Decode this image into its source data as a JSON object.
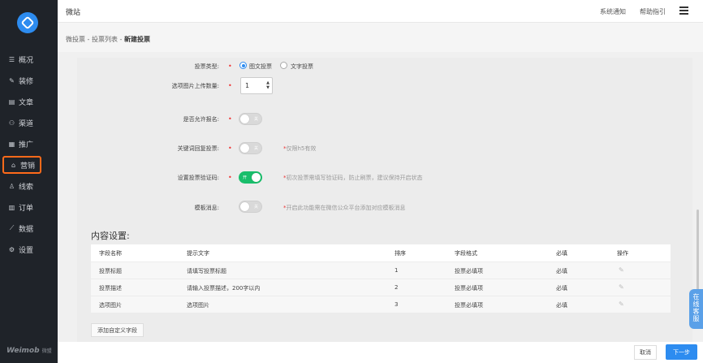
{
  "sidebar": {
    "brand": "Weimob",
    "brand_cn": "微盟",
    "items": [
      {
        "label": "概况",
        "icon": "overview-icon"
      },
      {
        "label": "装修",
        "icon": "decorate-icon"
      },
      {
        "label": "文章",
        "icon": "article-icon"
      },
      {
        "label": "渠道",
        "icon": "channel-icon"
      },
      {
        "label": "推广",
        "icon": "promote-icon"
      },
      {
        "label": "营销",
        "icon": "marketing-icon",
        "active": true
      },
      {
        "label": "线索",
        "icon": "leads-icon"
      },
      {
        "label": "订单",
        "icon": "order-icon"
      },
      {
        "label": "数据",
        "icon": "data-icon"
      },
      {
        "label": "设置",
        "icon": "settings-icon"
      }
    ]
  },
  "header": {
    "title": "微站",
    "notify": "系统通知",
    "help": "帮助指引"
  },
  "breadcrumb": {
    "part1": "微投票",
    "sep": " - ",
    "part2": "投票列表",
    "current": "新建投票"
  },
  "form": {
    "vote_type": {
      "label": "投票类型:",
      "options": [
        "图文投票",
        "文字投票"
      ],
      "selected": "图文投票"
    },
    "image_count": {
      "label": "选项图片上传数量:",
      "value": "1"
    },
    "allow_signup": {
      "label": "是否允许报名:",
      "state_text": "关",
      "on": false
    },
    "keyword_reply": {
      "label": "关键词回复投票:",
      "state_text": "关",
      "on": false,
      "hint_mark": "*",
      "hint": "仅限h5有效"
    },
    "captcha": {
      "label": "设置投票验证码:",
      "state_text": "开",
      "on": true,
      "hint_mark": "*",
      "hint": "初次投票需填写验证码，防止刷票，建议保持开启状态"
    },
    "template_msg": {
      "label": "模板消息:",
      "state_text": "关",
      "on": false,
      "hint_mark": "*",
      "hint": "开启此功能需在微信公众平台添加对应模板消息"
    }
  },
  "content_settings": {
    "title": "内容设置:",
    "columns": [
      "字段名称",
      "提示文字",
      "排序",
      "字段格式",
      "必填",
      "操作"
    ],
    "rows": [
      {
        "name": "投票标题",
        "hint": "请填写投票标题",
        "order": "1",
        "format": "投票必填项",
        "required": "必填"
      },
      {
        "name": "投票描述",
        "hint": "请输入投票描述，200字以内",
        "order": "2",
        "format": "投票必填项",
        "required": "必填"
      },
      {
        "name": "选项图片",
        "hint": "选项图片",
        "order": "3",
        "format": "投票必填项",
        "required": "必填"
      }
    ],
    "add_field": "添加自定义字段"
  },
  "footer": {
    "cancel": "取消",
    "next": "下一步"
  },
  "support_tab": "在线客服",
  "colors": {
    "accent": "#2d8cf0",
    "active_border": "#ff6a1a",
    "toggle_on": "#19be6b"
  }
}
